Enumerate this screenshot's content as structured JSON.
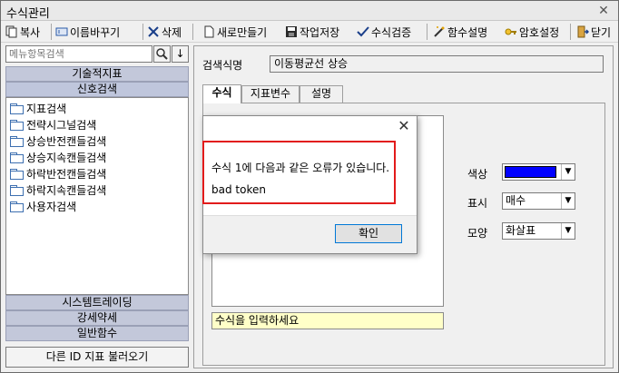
{
  "window": {
    "title": "수식관리",
    "close": "✕"
  },
  "toolbar": {
    "copy": "복사",
    "rename": "이름바꾸기",
    "delete": "삭제",
    "new": "새로만들기",
    "save": "작업저장",
    "verify": "수식검증",
    "func_help": "함수설명",
    "password": "암호설정",
    "close": "닫기"
  },
  "sidebar": {
    "search_placeholder": "메뉴항목검색",
    "down_arrow": "↓",
    "categories_top": [
      "기술적지표",
      "신호검색"
    ],
    "tree_items": [
      "지표검색",
      "전략시그널검색",
      "상승반전캔들검색",
      "상승지속캔들검색",
      "하락반전캔들검색",
      "하락지속캔들검색",
      "사용자검색"
    ],
    "categories_bottom": [
      "시스템트레이딩",
      "강세약세",
      "일반함수"
    ],
    "other_id_button": "다른 ID 지표 불러오기"
  },
  "main": {
    "search_name_label": "검색식명",
    "search_name_value": "이동평균선 상승",
    "tabs": [
      "수식",
      "지표변수",
      "설명"
    ],
    "formula_hint": "수식을 입력하세요",
    "color_label": "색상",
    "color_value": "#0000ff",
    "display_label": "표시",
    "display_value": "매수",
    "shape_label": "모양",
    "shape_value": "화살표"
  },
  "dialog": {
    "close": "✕",
    "message_line1": "수식 1에 다음과 같은 오류가 있습니다.",
    "message_line2": "bad token",
    "ok_button": "확인"
  }
}
